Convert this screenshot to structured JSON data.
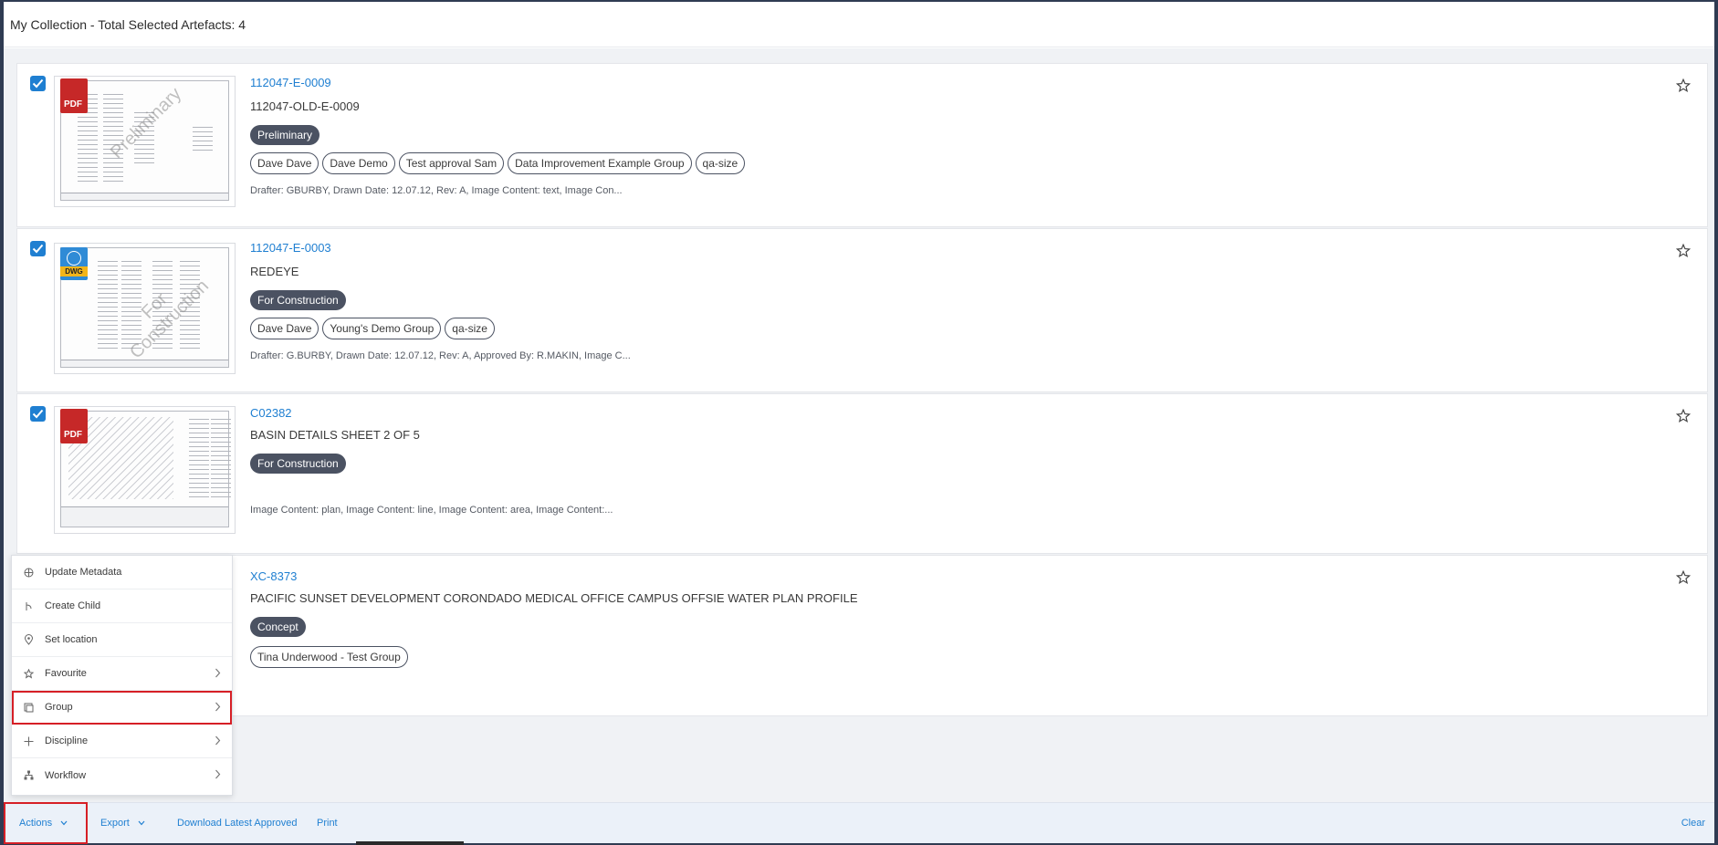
{
  "header": {
    "title": "My Collection - Total Selected Artefacts: 4"
  },
  "artefacts": [
    {
      "checked": true,
      "file_type": "PDF",
      "watermark": "Preliminary",
      "number": "112047-E-0009",
      "name": "112047-OLD-E-0009",
      "status": "Preliminary",
      "tags": [
        "Dave Dave",
        "Dave Demo",
        "Test approval Sam",
        "Data Improvement Example Group",
        "qa-size"
      ],
      "meta": "Drafter: GBURBY, Drawn Date: 12.07.12, Rev: A, Image Content: text, Image Con..."
    },
    {
      "checked": true,
      "file_type": "DWG",
      "watermark": "For Construction",
      "number": "112047-E-0003",
      "name": "REDEYE",
      "status": "For Construction",
      "tags": [
        "Dave Dave",
        "Young's Demo Group",
        "qa-size"
      ],
      "meta": "Drafter: G.BURBY, Drawn Date: 12.07.12, Rev: A, Approved By: R.MAKIN, Image C..."
    },
    {
      "checked": true,
      "file_type": "PDF",
      "watermark": "",
      "number": "C02382",
      "name": "BASIN DETAILS SHEET 2 OF 5",
      "status": "For Construction",
      "tags": [],
      "meta": "Image Content: plan, Image Content: line, Image Content: area, Image Content:..."
    },
    {
      "checked": true,
      "file_type": "",
      "watermark": "",
      "number": "XC-8373",
      "name": "PACIFIC SUNSET DEVELOPMENT CORONDADO MEDICAL OFFICE CAMPUS OFFSIE WATER PLAN PROFILE",
      "status": "Concept",
      "tags": [
        "Tina Underwood - Test Group"
      ],
      "meta": ""
    }
  ],
  "actions_menu": {
    "items": [
      {
        "label": "Update Metadata",
        "icon": "metadata-icon",
        "has_submenu": false,
        "highlighted": false
      },
      {
        "label": "Create Child",
        "icon": "branch-icon",
        "has_submenu": false,
        "highlighted": false
      },
      {
        "label": "Set location",
        "icon": "location-pin-icon",
        "has_submenu": false,
        "highlighted": false
      },
      {
        "label": "Favourite",
        "icon": "star-icon",
        "has_submenu": true,
        "highlighted": false
      },
      {
        "label": "Group",
        "icon": "group-icon",
        "has_submenu": true,
        "highlighted": true
      },
      {
        "label": "Discipline",
        "icon": "plus-icon",
        "has_submenu": true,
        "highlighted": false
      },
      {
        "label": "Workflow",
        "icon": "workflow-icon",
        "has_submenu": true,
        "highlighted": false
      }
    ]
  },
  "footer": {
    "actions_label": "Actions",
    "export_label": "Export",
    "download_label": "Download Latest Approved",
    "print_label": "Print",
    "clear_label": "Clear"
  },
  "colors": {
    "accent": "#1f7fd1",
    "status_badge": "#4b5262",
    "highlight_outline": "#d61f26",
    "pdf_badge": "#c62828",
    "dwg_badge": "#2f8bd6"
  }
}
